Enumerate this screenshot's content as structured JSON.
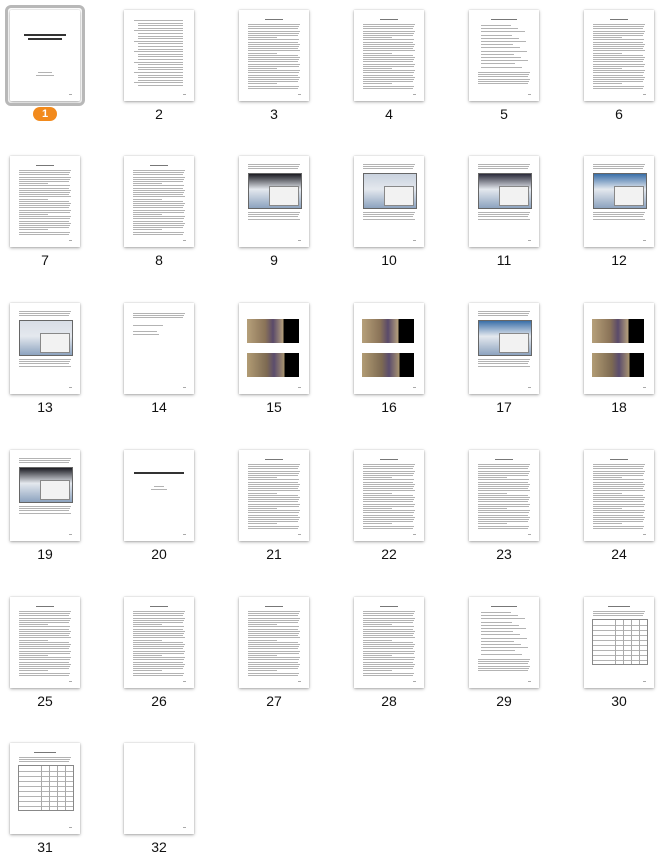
{
  "pages": [
    {
      "num": "1",
      "kind": "cover",
      "selected": true
    },
    {
      "num": "2",
      "kind": "toc"
    },
    {
      "num": "3",
      "kind": "text"
    },
    {
      "num": "4",
      "kind": "text"
    },
    {
      "num": "5",
      "kind": "list"
    },
    {
      "num": "6",
      "kind": "text"
    },
    {
      "num": "7",
      "kind": "text"
    },
    {
      "num": "8",
      "kind": "text"
    },
    {
      "num": "9",
      "kind": "screenshot"
    },
    {
      "num": "10",
      "kind": "screenshot"
    },
    {
      "num": "11",
      "kind": "screenshot"
    },
    {
      "num": "12",
      "kind": "screenshot"
    },
    {
      "num": "13",
      "kind": "screenshot"
    },
    {
      "num": "14",
      "kind": "sparse"
    },
    {
      "num": "15",
      "kind": "photo"
    },
    {
      "num": "16",
      "kind": "photo"
    },
    {
      "num": "17",
      "kind": "screenshot"
    },
    {
      "num": "18",
      "kind": "photo"
    },
    {
      "num": "19",
      "kind": "screenshot"
    },
    {
      "num": "20",
      "kind": "title"
    },
    {
      "num": "21",
      "kind": "text"
    },
    {
      "num": "22",
      "kind": "text"
    },
    {
      "num": "23",
      "kind": "text"
    },
    {
      "num": "24",
      "kind": "text"
    },
    {
      "num": "25",
      "kind": "text"
    },
    {
      "num": "26",
      "kind": "text"
    },
    {
      "num": "27",
      "kind": "text"
    },
    {
      "num": "28",
      "kind": "text"
    },
    {
      "num": "29",
      "kind": "list"
    },
    {
      "num": "30",
      "kind": "table"
    },
    {
      "num": "31",
      "kind": "table"
    },
    {
      "num": "32",
      "kind": "blank"
    }
  ],
  "colors": {
    "selection_badge": "#f28a1c",
    "selection_ring": "#b8b8b8"
  }
}
